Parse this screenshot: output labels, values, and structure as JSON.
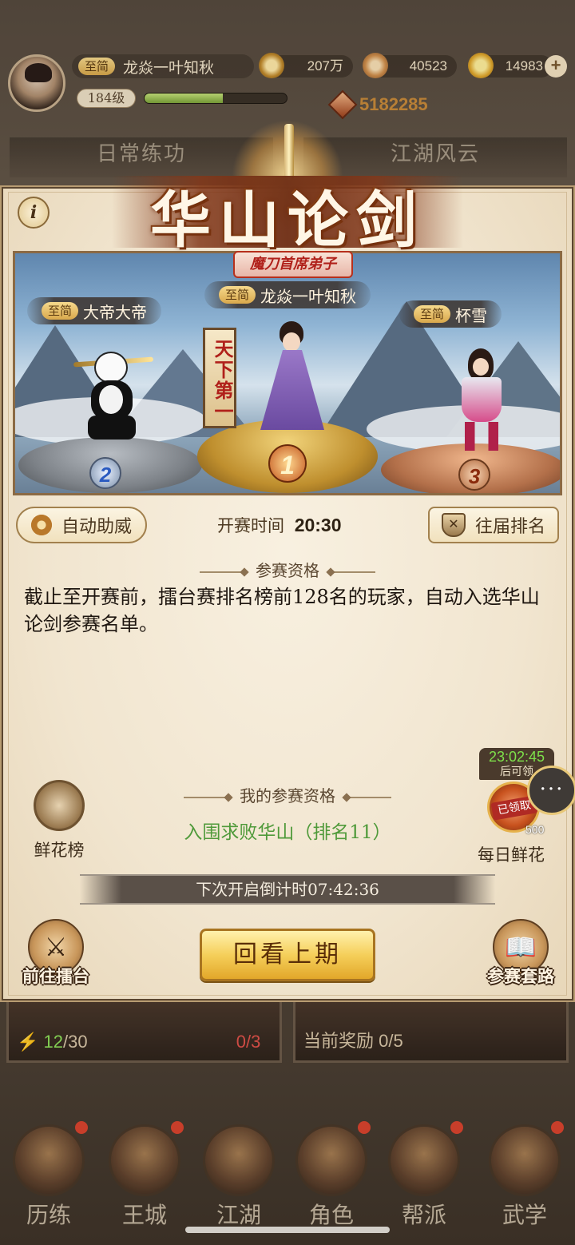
{
  "header": {
    "rank_badge": "至简",
    "player_name": "龙焱一叶知秋",
    "level": "184级",
    "exp_progress": 0.55,
    "coins": "207万",
    "stones": "40523",
    "ingots": "14983",
    "power": "5182285"
  },
  "background": {
    "tab_left": "日常练功",
    "tab_right": "江湖风云",
    "energy": "12/30",
    "energy_current": "12",
    "energy_total": "/30",
    "card_mid": "0/3",
    "reward_label": "当前奖励",
    "reward_value": "0/5",
    "nav": [
      "历练",
      "王城",
      "江湖",
      "角色",
      "帮派",
      "武学"
    ]
  },
  "panel": {
    "title": "华山论剑",
    "info_icon": "i",
    "podium": {
      "first_title": "魔刀首席弟子",
      "top_banner": "天下第一",
      "first": {
        "badge": "至简",
        "name": "龙焱一叶知秋",
        "place": "1"
      },
      "second": {
        "badge": "至简",
        "name": "大帝大帝",
        "place": "2"
      },
      "third": {
        "badge": "至简",
        "name": "杯雪",
        "place": "3"
      }
    },
    "auto_cheer_label": "自动助威",
    "start_time_label": "开赛时间",
    "start_time_value": "20:30",
    "past_rank_label": "往届排名",
    "qualification_heading": "参赛资格",
    "qualification_text": "截止至开赛前，擂台赛排名榜前128名的玩家，自动入选华山论剑参赛名单。",
    "my_qualification_heading": "我的参赛资格",
    "my_qualification_status": "入围求败华山（排名11）",
    "flower_rank_label": "鲜花榜",
    "daily_flower": {
      "timer": "23:02:45",
      "timer_note": "后可领",
      "claimed": "已领取",
      "count": "500",
      "label": "每日鲜花"
    },
    "chat_icon": "···",
    "countdown_text": "下次开启倒计时07:42:36",
    "replay_label": "回看上期",
    "goto_arena_label": "前往擂台",
    "routine_label": "参赛套路"
  },
  "colors": {
    "accent_gold": "#f5cf5a",
    "qualified_green": "#4f9a3a",
    "timer_green": "#7ee04a",
    "title_brown": "#6e2d10"
  }
}
